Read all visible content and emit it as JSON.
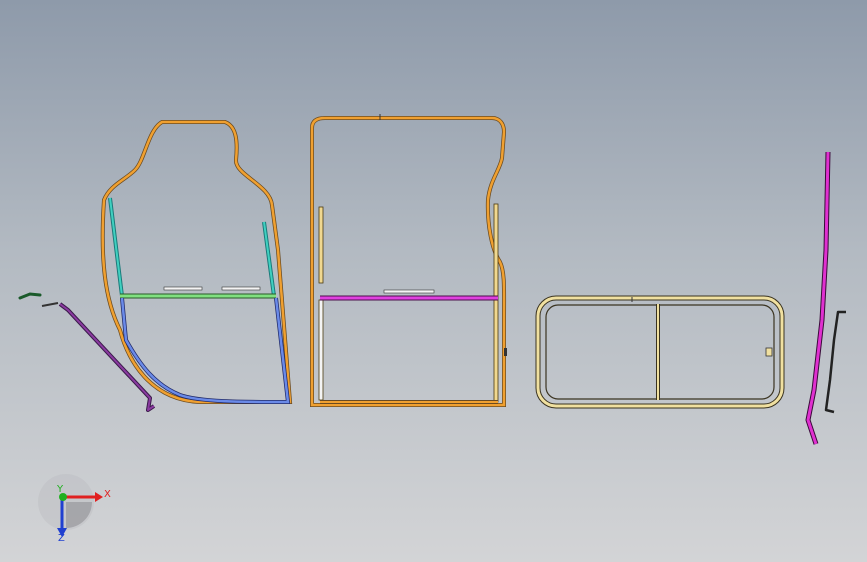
{
  "viewport": {
    "background_top": "#8e9aaa",
    "background_bottom": "#d3d4d6"
  },
  "triad": {
    "x_label": "X",
    "y_label": "Y",
    "z_label": "Z",
    "x_color": "#e02020",
    "y_color": "#20b020",
    "z_color": "#2040d0"
  },
  "parts": [
    {
      "name": "small-bracket",
      "color": "#1a5a2a"
    },
    {
      "name": "diagonal-rail",
      "color": "#7a2c8c"
    },
    {
      "name": "front-door-frame",
      "color": "#e8901c"
    },
    {
      "name": "rear-door-frame",
      "color": "#e8901c"
    },
    {
      "name": "window-frame",
      "color": "#e8dca0"
    },
    {
      "name": "vertical-rail",
      "color": "#d81cc8"
    },
    {
      "name": "hook-bracket",
      "color": "#222222"
    }
  ]
}
